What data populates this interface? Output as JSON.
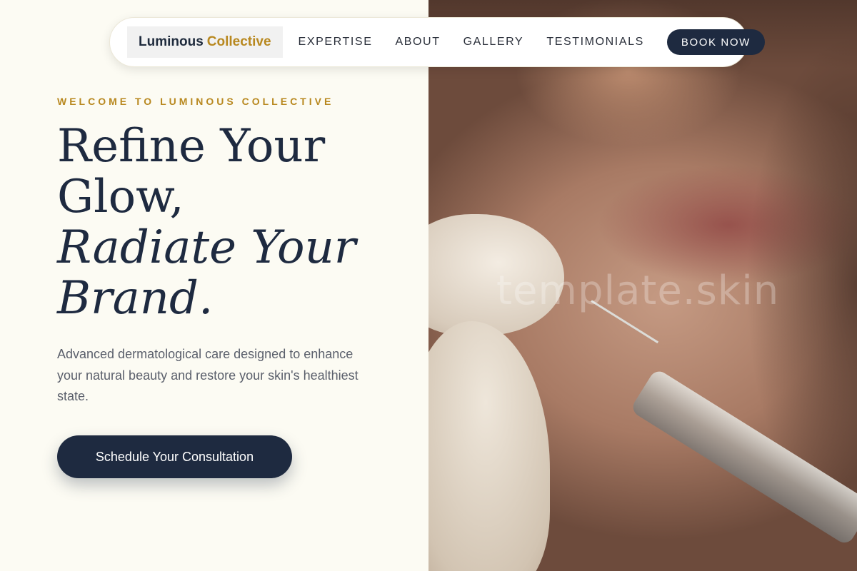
{
  "nav": {
    "brand_main": "Luminous",
    "brand_accent": "Collective",
    "links": [
      "EXPERTISE",
      "ABOUT",
      "GALLERY",
      "TESTIMONIALS"
    ],
    "book_label": "BOOK NOW"
  },
  "hero": {
    "eyebrow": "WELCOME TO LUMINOUS COLLECTIVE",
    "headline_line1": "Refine Your",
    "headline_line2": "Glow,",
    "headline_line3": "Radiate Your",
    "headline_line4": "Brand.",
    "description": "Advanced dermatological care designed to enhance your natural beauty and restore your skin's healthiest state.",
    "cta_label": "Schedule Your Consultation"
  },
  "photo": {
    "watermark": "template.skin"
  },
  "colors": {
    "navy": "#1e2a40",
    "gold": "#b8881f",
    "background": "#fcfbf3"
  }
}
